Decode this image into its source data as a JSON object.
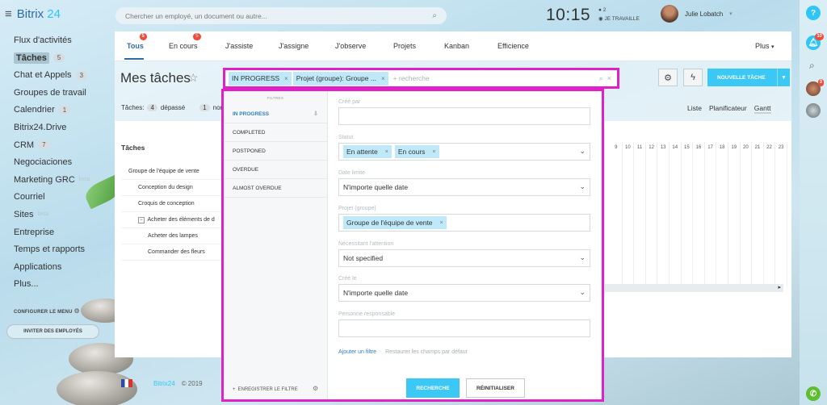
{
  "app": {
    "logo_main": "Bitrix",
    "logo_num": "24"
  },
  "search": {
    "placeholder": "Chercher un employé, un document ou autre..."
  },
  "clock": {
    "time": "10:15",
    "count": "2",
    "status": "JE TRAVAILLE"
  },
  "user": {
    "name": "Julie Lobatch"
  },
  "sidebar": {
    "items": [
      {
        "label": "Flux d'activités"
      },
      {
        "label": "Tâches",
        "count": "5",
        "active": true
      },
      {
        "label": "Chat et Appels",
        "count": "3"
      },
      {
        "label": "Groupes de travail"
      },
      {
        "label": "Calendrier",
        "count": "1"
      },
      {
        "label": "Bitrix24.Drive"
      },
      {
        "label": "CRM",
        "count": "7"
      },
      {
        "label": "Negociaciones"
      },
      {
        "label": "Marketing GRC",
        "ghost": "beta"
      },
      {
        "label": "Courriel"
      },
      {
        "label": "Sites",
        "ghost": "beta"
      },
      {
        "label": "Entreprise"
      },
      {
        "label": "Temps et rapports"
      },
      {
        "label": "Applications"
      },
      {
        "label": "Plus..."
      }
    ],
    "config_menu": "CONFIGURER LE MENU",
    "invite": "INVITER DES EMPLOYÉS"
  },
  "tabs": [
    {
      "label": "Tous",
      "badge": "5",
      "active": true
    },
    {
      "label": "En cours",
      "badge": "5"
    },
    {
      "label": "J'assiste"
    },
    {
      "label": "J'assigne"
    },
    {
      "label": "J'observe"
    },
    {
      "label": "Projets"
    },
    {
      "label": "Kanban"
    },
    {
      "label": "Efficience"
    }
  ],
  "more_tab": "Plus",
  "page": {
    "title": "Mes tâches",
    "new_task": "NOUVELLE TÂCHE"
  },
  "counters": {
    "label": "Tâches:",
    "overdue_count": "4",
    "overdue": "dépassé",
    "other_count": "1",
    "other": "non v"
  },
  "views": [
    "Liste",
    "Planificateur",
    "Gantt"
  ],
  "table": {
    "header": "Tâches",
    "rows": [
      "Groupe de l'équipe de vente",
      "Conception du design",
      "Croquis de conception",
      "Acheter des éléments de d",
      "Acheter des lampes",
      "Commander des fleurs"
    ]
  },
  "gantt_days": [
    "9",
    "10",
    "11",
    "12",
    "13",
    "14",
    "15",
    "16",
    "17",
    "18",
    "19",
    "20",
    "21",
    "22",
    "23"
  ],
  "footer": {
    "brand": "Bitrix24",
    "copyright": "© 2019"
  },
  "filter_bar": {
    "tags": [
      "IN PROGRESS",
      "Projet (groupe): Groupe ..."
    ],
    "placeholder": "+ recherche"
  },
  "filter_popup": {
    "list_header": "FILTRES",
    "presets": [
      "IN PROGRESS",
      "COMPLETED",
      "POSTPONED",
      "OVERDUE",
      "ALMOST OVERDUE"
    ],
    "save_filter": "ENREGISTRER LE FILTRE",
    "fields": {
      "created_by": {
        "label": "Créé par"
      },
      "status": {
        "label": "Statut",
        "chips": [
          "En attente",
          "En cours"
        ]
      },
      "deadline": {
        "label": "Date limite",
        "value": "N'importe quelle date"
      },
      "project": {
        "label": "Projet (groupe)",
        "chips": [
          "Groupe de l'équipe de vente"
        ]
      },
      "attention": {
        "label": "Nécessitant l'attention",
        "value": "Not specified"
      },
      "created": {
        "label": "Créé le",
        "value": "N'importe quelle date"
      },
      "responsible": {
        "label": "Personne responsable"
      }
    },
    "add_filter": "Ajouter un filtre",
    "restore": "Restaurer les champs par défaut",
    "search_btn": "RECHERCHE",
    "reset_btn": "RÉINITIALISER"
  },
  "right_bar": {
    "help_badge": "",
    "notif_badge": "10",
    "avatar_badge": "3"
  }
}
